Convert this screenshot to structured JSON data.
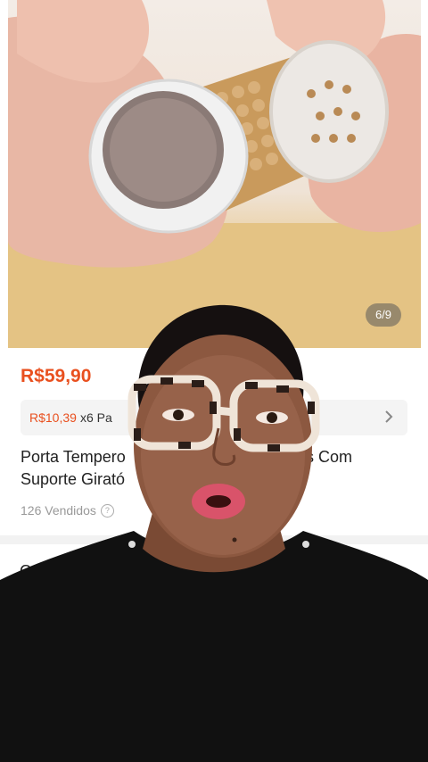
{
  "gallery": {
    "counter": "6/9",
    "image_icon": "spice-jar-photo"
  },
  "product": {
    "price": "R$59,90",
    "installment": {
      "price": "R$10,39",
      "text": "x6 Pa"
    },
    "title_line1": "Porta Tempero",
    "title_line1_end": "s Com",
    "title_line2": "Suporte Girató",
    "sold": "126 Vendidos",
    "help_icon_char": "?"
  },
  "section": {
    "peek_label": "C"
  },
  "colors": {
    "price": "#e9501f",
    "coupon_bg": "#f4f4f4",
    "divider": "#f2f2f2"
  }
}
